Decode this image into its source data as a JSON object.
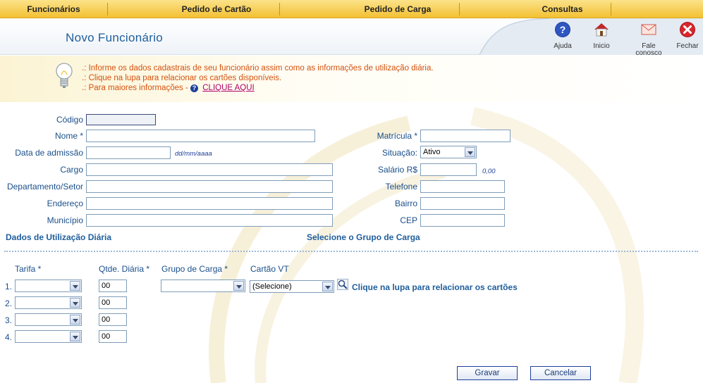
{
  "nav": {
    "items": [
      "Funcionários",
      "Pedido de Cartão",
      "Pedido de Carga",
      "Consultas"
    ]
  },
  "header": {
    "title": "Novo Funcionário",
    "buttons": {
      "ajuda": "Ajuda",
      "inicio": "Inicio",
      "fale_1": "Fale",
      "fale_2": "conosco",
      "fechar": "Fechar"
    }
  },
  "info": {
    "line1": ".: Informe os dados cadastrais de seu funcionário assim como as informações de utilização diária.",
    "line2": ".: Clique na lupa para relacionar os cartões disponíveis.",
    "line3": ".: Para maiores informações -",
    "link": "CLIQUE AQUI",
    "help_glyph": "?"
  },
  "form": {
    "codigo": {
      "label": "Código",
      "value": ""
    },
    "nome": {
      "label": "Nome *",
      "value": ""
    },
    "data_admissao": {
      "label": "Data de admissão",
      "value": "",
      "hint": "dd/mm/aaaa"
    },
    "cargo": {
      "label": "Cargo",
      "value": ""
    },
    "departamento": {
      "label": "Departamento/Setor",
      "value": ""
    },
    "endereco": {
      "label": "Endereço",
      "value": ""
    },
    "municipio": {
      "label": "Município",
      "value": ""
    },
    "matricula": {
      "label": "Matrícula *",
      "value": ""
    },
    "situacao": {
      "label": "Situação:",
      "value": "Ativo"
    },
    "salario": {
      "label": "Salário R$",
      "value": "",
      "hint": "0,00"
    },
    "telefone": {
      "label": "Telefone",
      "value": ""
    },
    "bairro": {
      "label": "Bairro",
      "value": ""
    },
    "cep": {
      "label": "CEP",
      "value": ""
    }
  },
  "sections": {
    "dados_utilizacao": "Dados de Utilização Diária",
    "grupo_carga": "Selecione o Grupo de Carga"
  },
  "usage": {
    "columns": {
      "tarifa": "Tarifa *",
      "qtde": "Qtde. Diária *",
      "grupo": "Grupo de Carga *",
      "cartao": "Cartão VT"
    },
    "rows": [
      {
        "num": "1.",
        "tarifa": "",
        "qtde": "00"
      },
      {
        "num": "2.",
        "tarifa": "",
        "qtde": "00"
      },
      {
        "num": "3.",
        "tarifa": "",
        "qtde": "00"
      },
      {
        "num": "4.",
        "tarifa": "",
        "qtde": "00"
      }
    ],
    "grupo_value": "",
    "cartao_value": "(Selecione)",
    "lupa_text": "Clique na lupa para relacionar os cartões"
  },
  "actions": {
    "gravar": "Gravar",
    "cancelar": "Cancelar"
  },
  "colors": {
    "nav_bg": "#f3c032",
    "label": "#1a4f8a",
    "info_text": "#d4520f",
    "link": "#b0006a"
  }
}
